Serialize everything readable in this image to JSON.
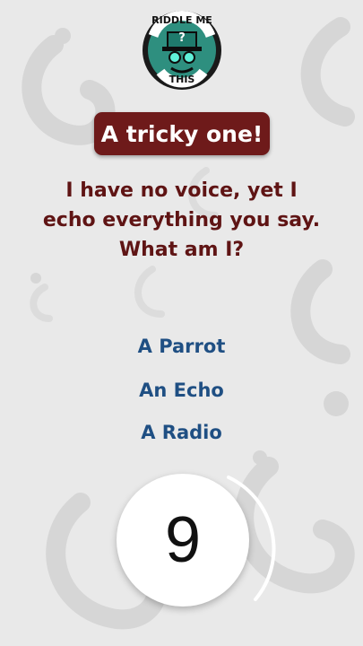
{
  "logo": {
    "top_text": "RIDDLE ME",
    "bottom_text": "THIS",
    "center_glyph": "?"
  },
  "badge": {
    "label": "A tricky one!"
  },
  "question": {
    "lines": [
      "I have no voice, yet I",
      "echo everything you say.",
      "What am I?"
    ]
  },
  "options": [
    {
      "label": "A Parrot"
    },
    {
      "label": "An Echo"
    },
    {
      "label": "A Radio"
    }
  ],
  "timer": {
    "value": "9"
  },
  "colors": {
    "background": "#e9e9e9",
    "badge": "#6e1a1a",
    "question_text": "#5f1414",
    "option_text": "#1f4f83",
    "logo_teal": "#1f7a6c"
  },
  "background_icon": "question-mark-pattern"
}
